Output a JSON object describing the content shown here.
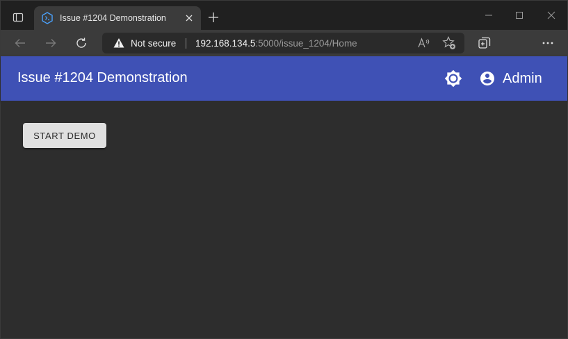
{
  "browser": {
    "tab": {
      "title": "Issue #1204 Demonstration"
    },
    "omnibox": {
      "security_label": "Not secure",
      "url_host": "192.168.134.5",
      "url_rest": ":5000/issue_1204/Home"
    }
  },
  "app": {
    "title": "Issue #1204 Demonstration",
    "user_name": "Admin",
    "start_button_label": "START DEMO",
    "colors": {
      "app_bar": "#3f51b5",
      "background": "#2d2d2d",
      "button": "#e0e0e0"
    },
    "icons": {
      "theme": "brightness-icon",
      "user": "account-circle-icon"
    }
  }
}
